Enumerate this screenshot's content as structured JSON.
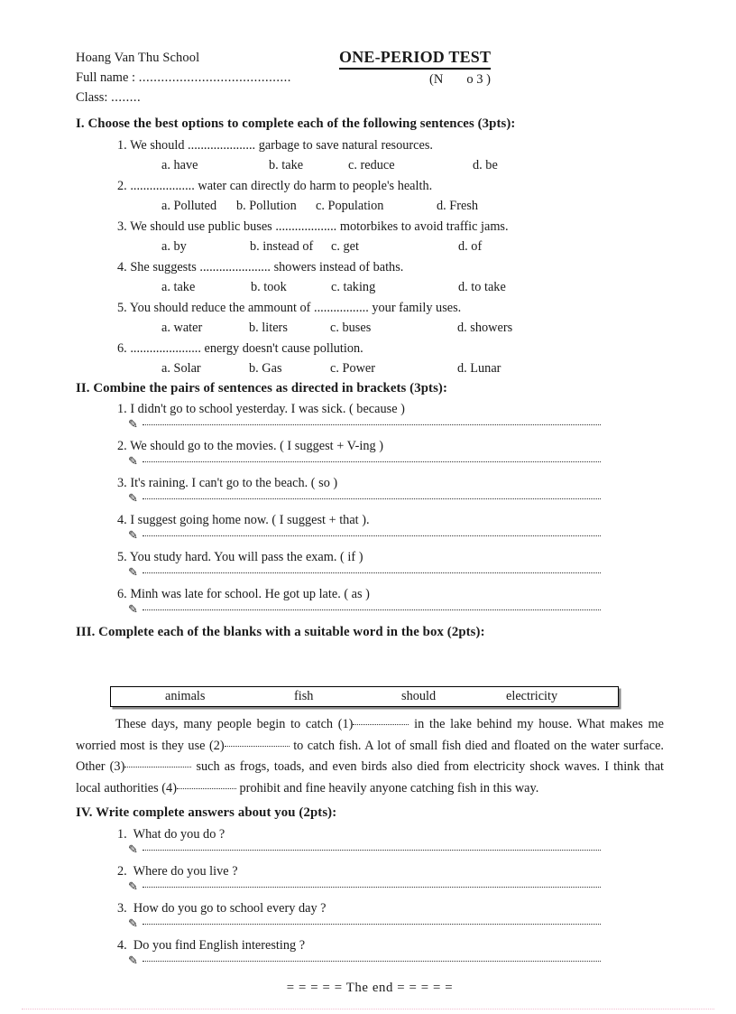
{
  "header": {
    "school": "Hoang Van Thu School",
    "title": "ONE-PERIOD TEST",
    "grade_prefix": "(N",
    "grade_suffix": "o 3 )",
    "fullname_label": "Full name : ",
    "fullname_dots": ".........................................",
    "class_label": "Class: ",
    "class_dots": "........"
  },
  "section1": {
    "heading": "I. Choose the best options to complete each of the following sentences (3pts):",
    "questions": [
      {
        "number": "1.",
        "text_before": "We should",
        "dots": ".....................",
        "text_after": "garbage to save natural resources.",
        "options": [
          "a. have",
          "b. take",
          "c. reduce",
          "d. be"
        ]
      },
      {
        "number": "2.",
        "text_before": "",
        "dots": "....................",
        "text_after": "water can directly do harm to people's health.",
        "options": [
          "a. Polluted",
          "b. Pollution",
          "c. Population",
          "d. Fresh"
        ]
      },
      {
        "number": "3.",
        "text_before": "We should use public buses",
        "dots": "...................",
        "text_after": "motorbikes to avoid traffic jams.",
        "options": [
          "a. by",
          "b. instead of",
          "c. get",
          "d. of"
        ]
      },
      {
        "number": "4.",
        "text_before": "She suggests",
        "dots": "......................",
        "text_after": "showers instead of baths.",
        "options": [
          "a. take",
          "b. took",
          "c. taking",
          "d. to take"
        ]
      },
      {
        "number": "5.",
        "text_before": "You should reduce the ammount of",
        "dots": ".................",
        "text_after": "your family uses.",
        "options": [
          "a. water",
          "b. liters",
          "c. buses",
          "d. showers"
        ]
      },
      {
        "number": "6.",
        "text_before": "",
        "dots": "......................",
        "text_after": "energy doesn't cause pollution.",
        "options": [
          "a. Solar",
          "b. Gas",
          "c. Power",
          "d. Lunar"
        ]
      }
    ]
  },
  "section2": {
    "heading": "II. Combine the pairs of sentences as directed in brackets (3pts):",
    "pen_glyph": "✎",
    "items": [
      {
        "number": "1.",
        "text": "I didn't go to school yesterday. I was sick. ( because )"
      },
      {
        "number": "2.",
        "text": "We should go to the movies. ( I suggest + V-ing )"
      },
      {
        "number": "3.",
        "text": "It's raining. I can't go to the beach. ( so )"
      },
      {
        "number": "4.",
        "text": "I suggest going home now. ( I suggest + that )."
      },
      {
        "number": "5.",
        "text": "You study hard. You will pass the exam. ( if )"
      },
      {
        "number": "6.",
        "text": "Minh was late for school. He got up late. ( as )"
      }
    ]
  },
  "section3": {
    "heading": "III. Complete each of the blanks with a suitable word in the box (2pts):",
    "word_box": [
      "animals",
      "fish",
      "should",
      "electricity"
    ],
    "paragraph": {
      "p1": "These days, many people begin to catch (1)",
      "p2": "in the lake behind my house. What makes me worried most is they use (2)",
      "p3": "to catch fish. A lot of small fish died and floated on the water surface. Other (3)",
      "p4": "such as frogs, toads, and even birds also died from electricity shock waves. I think that local authorities (4)",
      "p5": "prohibit and fine heavily anyone catching fish in this way."
    }
  },
  "section4": {
    "heading": "IV. Write complete answers about you (2pts):",
    "pen_glyph": "✎",
    "items": [
      {
        "number": "1.",
        "text": "What do you do ?"
      },
      {
        "number": "2.",
        "text": "Where do you live ?"
      },
      {
        "number": "3.",
        "text": "How do you go to school every day ?"
      },
      {
        "number": "4.",
        "text": "Do you find English interesting ?"
      }
    ]
  },
  "footer": {
    "the_end": "= = = = = The end = = = = ="
  },
  "colors": {
    "text": "#1a1a1a",
    "box_shadow": "#8a8a8a",
    "bottom_rule": "#f3bcd0"
  }
}
